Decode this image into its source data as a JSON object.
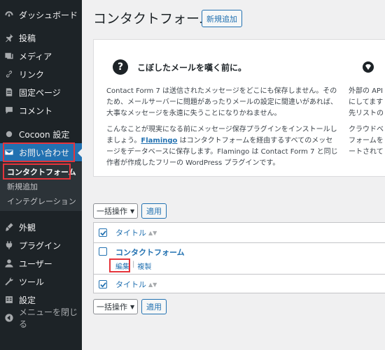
{
  "sidebar": {
    "items": [
      {
        "label": "ダッシュボード",
        "icon": "dashboard-icon"
      },
      {
        "label": "投稿",
        "icon": "pin-icon"
      },
      {
        "label": "メディア",
        "icon": "media-icon"
      },
      {
        "label": "リンク",
        "icon": "link-icon"
      },
      {
        "label": "固定ページ",
        "icon": "page-icon"
      },
      {
        "label": "コメント",
        "icon": "comment-icon"
      },
      {
        "label": "Cocoon 設定",
        "icon": "circle-icon"
      },
      {
        "label": "お問い合わせ",
        "icon": "mail-icon"
      },
      {
        "label": "外観",
        "icon": "brush-icon"
      },
      {
        "label": "プラグイン",
        "icon": "plugin-icon"
      },
      {
        "label": "ユーザー",
        "icon": "user-icon"
      },
      {
        "label": "ツール",
        "icon": "wrench-icon"
      },
      {
        "label": "設定",
        "icon": "settings-icon"
      },
      {
        "label": "メニューを閉じる",
        "icon": "collapse-icon"
      }
    ],
    "submenu": [
      {
        "label": "コンタクトフォーム"
      },
      {
        "label": "新規追加"
      },
      {
        "label": "インテグレーション"
      }
    ]
  },
  "header": {
    "title": "コンタクトフォーム",
    "add_new": "新規追加"
  },
  "notice": {
    "title": "こぼしたメールを嘆く前に。",
    "p1": "Contact Form 7 は送信されたメッセージをどこにも保存しません。そのため、メールサーバーに問題があったりメールの設定に間違いがあれば、大事なメッセージを永遠に失うことになりかねません。",
    "p2_before": "こんなことが現実になる前にメッセージ保存プラグインをインストールしましょう。",
    "p2_link": "Flamingo",
    "p2_after": " はコンタクトフォームを経由するすべてのメッセージをデータベースに保存します。Flamingo は Contact Form 7 と同じ作者が作成したフリーの WordPress プラグインです。",
    "col2_lines": [
      "外部の API",
      "にしてます",
      "先リストの",
      "クラウドベ",
      "フォームを",
      "ートされて"
    ]
  },
  "bulk": {
    "select": "一括操作",
    "apply": "適用"
  },
  "table": {
    "header": "タイトル",
    "footer": "タイトル",
    "rows": [
      {
        "title": "コンタクトフォーム",
        "edit": "編集",
        "copy": "複製"
      }
    ]
  },
  "colors": {
    "sidebar_bg": "#1d2327",
    "active_bg": "#2271b1",
    "link": "#2271b1",
    "highlight": "#e5343b"
  }
}
